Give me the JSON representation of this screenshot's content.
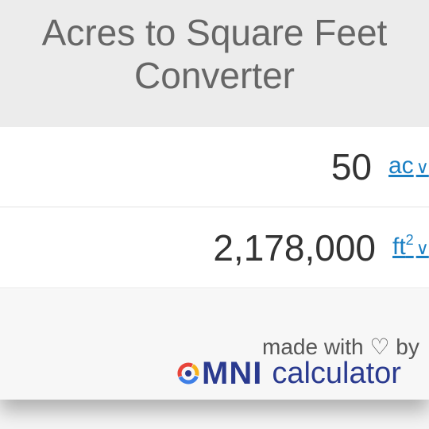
{
  "header": {
    "title": "Acres to Square Feet Converter"
  },
  "rows": [
    {
      "value": "50",
      "unit": "ac",
      "unit_sup": "",
      "caret": "∨"
    },
    {
      "value": "2,178,000",
      "unit": "ft",
      "unit_sup": "2",
      "caret": "∨"
    }
  ],
  "footer": {
    "made_with": "made with ♡ by",
    "brand_omni": "MNI",
    "brand_calculator": "calculator"
  },
  "colors": {
    "link": "#1a7fc3",
    "brand": "#2a3a8f",
    "logo_ring": [
      "#e8443a",
      "#f6b21b",
      "#3f7fe6"
    ]
  },
  "icons": {
    "unit_dropdown": "chevron-down-icon",
    "brand_logo": "omni-logo-icon"
  }
}
